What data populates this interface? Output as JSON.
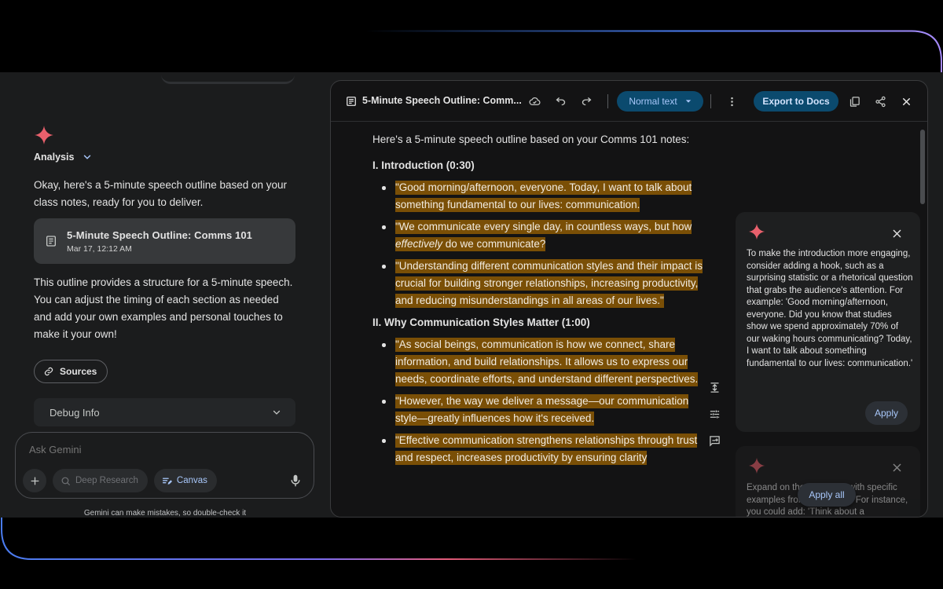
{
  "chat": {
    "analysis_label": "Analysis",
    "intro_text": "Okay, here's a 5-minute speech outline based on your class notes, ready for you to deliver.",
    "doc_card": {
      "title": "5-Minute Speech Outline: Comms 101",
      "timestamp": "Mar 17, 12:12 AM"
    },
    "body_text": "This outline provides a structure for a 5-minute speech.  You can adjust the timing of each section as needed and add your own examples and personal touches to make it your own!",
    "sources_label": "Sources",
    "debug_label": "Debug Info",
    "ask_placeholder": "Ask Gemini",
    "deep_research_label": "Deep Research",
    "canvas_label": "Canvas",
    "disclaimer": "Gemini can make mistakes, so double-check it"
  },
  "canvas": {
    "title": "5-Minute Speech Outline: Comm...",
    "style_select": "Normal text",
    "export_label": "Export to Docs",
    "doc": {
      "intro": "Here's a 5-minute speech outline based on your Comms 101 notes:",
      "section1_heading": "I. Introduction (0:30)",
      "section1_items": [
        "\"Good morning/afternoon, everyone. Today, I want to talk about something fundamental to our lives: communication.",
        "\"Understanding different communication styles and their impact is crucial for building stronger relationships, increasing productivity, and reducing misunderstandings in all areas of our lives.\""
      ],
      "section1_item2": {
        "before": "\"We communicate every single day, in countless ways, but how ",
        "emphasis": "effectively",
        "after": " do we communicate?"
      },
      "section2_heading": "II. Why Communication Styles Matter (1:00)",
      "section2_items": [
        "\"As social beings, communication is how we connect, share information, and build relationships. It allows us to express our needs, coordinate efforts, and understand different perspectives.",
        "\"However, the way we deliver a message—our communication style—greatly influences how it's received.",
        "\"Effective communication strengthens relationships through trust and respect, increases productivity by ensuring clarity"
      ]
    },
    "suggestions": [
      {
        "text": "To make the introduction more engaging, consider adding a hook, such as a surprising statistic or a rhetorical question that grabs the audience's attention. For example: 'Good morning/afternoon, everyone. Did you know that studies show we spend approximately 70% of our waking hours communicating? Today, I want to talk about something fundamental to our lives: communication.'",
        "apply_label": "Apply"
      },
      {
        "text": "Expand on the examples with specific examples from your notes. For instance, you could add: 'Think about a"
      }
    ],
    "apply_all_label": "Apply all"
  },
  "colors": {
    "highlight": "#7a4f06",
    "accent_blue": "#a8c7fa",
    "gemini_spark": "#e8606c",
    "button_bg": "#0b4a6e"
  }
}
